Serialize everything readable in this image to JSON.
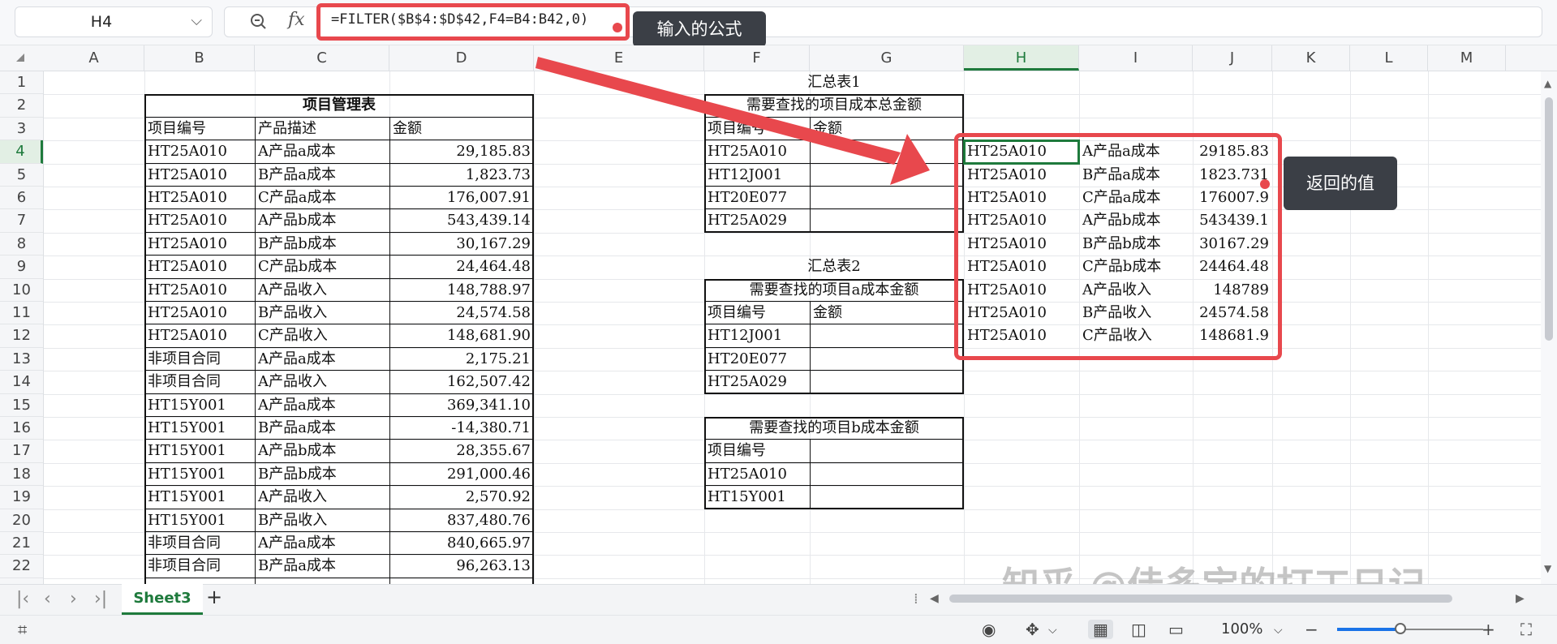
{
  "name_box": "H4",
  "formula": "=FILTER($B$4:$D$42,F4=B4:B42,0)",
  "callouts": {
    "formula_note": "输入的公式",
    "result_note": "返回的值"
  },
  "columns": [
    "A",
    "B",
    "C",
    "D",
    "E",
    "F",
    "G",
    "H",
    "I",
    "J",
    "K",
    "L",
    "M"
  ],
  "rows": [
    "1",
    "2",
    "3",
    "4",
    "5",
    "6",
    "7",
    "8",
    "9",
    "10",
    "11",
    "12",
    "13",
    "14",
    "15",
    "16",
    "17",
    "18",
    "19",
    "20",
    "21",
    "22"
  ],
  "main_table": {
    "title": "项目管理表",
    "headers": [
      "项目编号",
      "产品描述",
      "金额"
    ],
    "rows": [
      [
        "HT25A010",
        "A产品a成本",
        "29,185.83"
      ],
      [
        "HT25A010",
        "B产品a成本",
        "1,823.73"
      ],
      [
        "HT25A010",
        "C产品a成本",
        "176,007.91"
      ],
      [
        "HT25A010",
        "A产品b成本",
        "543,439.14"
      ],
      [
        "HT25A010",
        "B产品b成本",
        "30,167.29"
      ],
      [
        "HT25A010",
        "C产品b成本",
        "24,464.48"
      ],
      [
        "HT25A010",
        "A产品收入",
        "148,788.97"
      ],
      [
        "HT25A010",
        "B产品收入",
        "24,574.58"
      ],
      [
        "HT25A010",
        "C产品收入",
        "148,681.90"
      ],
      [
        "非项目合同",
        "A产品a成本",
        "2,175.21"
      ],
      [
        "非项目合同",
        "A产品收入",
        "162,507.42"
      ],
      [
        "HT15Y001",
        "A产品a成本",
        "369,341.10"
      ],
      [
        "HT15Y001",
        "B产品a成本",
        "-14,380.71"
      ],
      [
        "HT15Y001",
        "A产品b成本",
        "28,355.67"
      ],
      [
        "HT15Y001",
        "B产品b成本",
        "291,000.46"
      ],
      [
        "HT15Y001",
        "A产品收入",
        "2,570.92"
      ],
      [
        "HT15Y001",
        "B产品收入",
        "837,480.76"
      ],
      [
        "非项目合同",
        "A产品a成本",
        "840,665.97"
      ],
      [
        "非项目合同",
        "B产品a成本",
        "96,263.13"
      ]
    ]
  },
  "summary1": {
    "caption": "汇总表1",
    "title": "需要查找的项目成本总金额",
    "headers": [
      "项目编号",
      "金额"
    ],
    "ids": [
      "HT25A010",
      "HT12J001",
      "HT20E077",
      "HT25A029"
    ]
  },
  "summary2": {
    "caption": "汇总表2",
    "title": "需要查找的项目a成本金额",
    "headers": [
      "项目编号",
      "金额"
    ],
    "ids": [
      "HT12J001",
      "HT20E077",
      "HT25A029"
    ]
  },
  "summary3": {
    "title": "需要查找的项目b成本金额",
    "headers": [
      "项目编号"
    ],
    "ids": [
      "HT25A010",
      "HT15Y001"
    ]
  },
  "filter_result": [
    [
      "HT25A010",
      "A产品a成本",
      "29185.83"
    ],
    [
      "HT25A010",
      "B产品a成本",
      "1823.731"
    ],
    [
      "HT25A010",
      "C产品a成本",
      "176007.9"
    ],
    [
      "HT25A010",
      "A产品b成本",
      "543439.1"
    ],
    [
      "HT25A010",
      "B产品b成本",
      "30167.29"
    ],
    [
      "HT25A010",
      "C产品b成本",
      "24464.48"
    ],
    [
      "HT25A010",
      "A产品收入",
      "148789"
    ],
    [
      "HT25A010",
      "B产品收入",
      "24574.58"
    ],
    [
      "HT25A010",
      "C产品收入",
      "148681.9"
    ]
  ],
  "sheet_tab": "Sheet3",
  "zoom": "100%",
  "watermark": "知乎 @佳多宝的打工日记",
  "accent_color": "#1e7a3c",
  "highlight_color": "#e8484d"
}
